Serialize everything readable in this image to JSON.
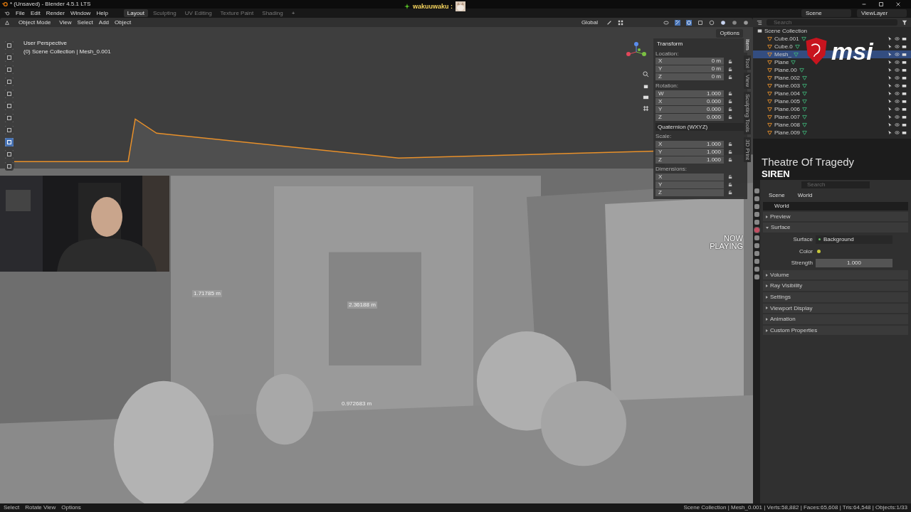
{
  "title_bar": {
    "title": "* (Unsaved) - Blender 4.5.1 LTS"
  },
  "menu": [
    "File",
    "Edit",
    "Render",
    "Window",
    "Help"
  ],
  "workspaces": [
    {
      "label": "Layout",
      "selected": true
    },
    {
      "label": "Sculpting",
      "selected": false
    },
    {
      "label": "UV Editing",
      "selected": false
    },
    {
      "label": "Texture Paint",
      "selected": false
    },
    {
      "label": "Shading",
      "selected": false
    }
  ],
  "add_workspace": "+",
  "scene_selector": {
    "scene": "Scene",
    "view_layer": "ViewLayer"
  },
  "chat": {
    "user": "wakuuwaku :"
  },
  "viewport_header": {
    "mode": "Object Mode",
    "menu": [
      "View",
      "Select",
      "Add",
      "Object"
    ],
    "orientation": "Global",
    "options": "Options"
  },
  "toolbar": [
    {
      "selected": false
    },
    {
      "selected": false
    },
    {
      "selected": false
    },
    {
      "selected": false
    },
    {
      "selected": false
    },
    {
      "selected": false
    },
    {
      "selected": false
    },
    {
      "selected": false
    },
    {
      "selected": true
    },
    {
      "selected": false
    },
    {
      "selected": false
    }
  ],
  "viewport": {
    "view_name": "User Perspective",
    "collection": "(0) Scene Collection | Mesh_0.001",
    "measurements": [
      {
        "text": "1.71785 m",
        "kind": "left"
      },
      {
        "text": "2.36188 m",
        "kind": "middle"
      },
      {
        "text": "0.972683 m",
        "kind": "bottom"
      }
    ]
  },
  "n_panel": {
    "title": "Transform",
    "tabs": [
      {
        "label": "Item",
        "selected": true
      },
      {
        "label": "Tool",
        "selected": false
      },
      {
        "label": "View",
        "selected": false
      },
      {
        "label": "Sculpting Tools",
        "selected": false
      },
      {
        "label": "3D Print",
        "selected": false
      }
    ],
    "sections": [
      {
        "kind": "group",
        "label": "Location:",
        "fields": [
          {
            "axis": "X",
            "value": "0 m"
          },
          {
            "axis": "Y",
            "value": "0 m"
          },
          {
            "axis": "Z",
            "value": "0 m"
          }
        ]
      },
      {
        "kind": "group",
        "label": "Rotation:",
        "fields": [
          {
            "axis": "W",
            "value": "1.000"
          },
          {
            "axis": "X",
            "value": "0.000"
          },
          {
            "axis": "Y",
            "value": "0.000"
          },
          {
            "axis": "Z",
            "value": "0.000"
          }
        ]
      },
      {
        "kind": "dropdown",
        "label": "Quaternion (WXYZ)"
      },
      {
        "kind": "group",
        "label": "Scale:",
        "fields": [
          {
            "axis": "X",
            "value": "1.000"
          },
          {
            "axis": "Y",
            "value": "1.000"
          },
          {
            "axis": "Z",
            "value": "1.000"
          }
        ]
      },
      {
        "kind": "group",
        "label": "Dimensions:",
        "fields": [
          {
            "axis": "X"
          },
          {
            "axis": "Y"
          },
          {
            "axis": "Z"
          }
        ]
      }
    ]
  },
  "now_playing": {
    "label": "NOW PLAYING",
    "title": "Theatre Of Tragedy",
    "artist": "SIREN"
  },
  "outliner": {
    "search": {
      "placeholder": "Search"
    },
    "root": "Scene Collection",
    "items": [
      {
        "name": "Cube.001",
        "selected": false
      },
      {
        "name": "Cube.0",
        "selected": false
      },
      {
        "name": "Mesh_",
        "selected": true
      },
      {
        "name": "Plane",
        "selected": false
      },
      {
        "name": "Plane.00",
        "selected": false
      },
      {
        "name": "Plane.002",
        "selected": false
      },
      {
        "name": "Plane.003",
        "selected": false
      },
      {
        "name": "Plane.004",
        "selected": false
      },
      {
        "name": "Plane.005",
        "selected": false
      },
      {
        "name": "Plane.006",
        "selected": false
      },
      {
        "name": "Plane.007",
        "selected": false
      },
      {
        "name": "Plane.008",
        "selected": false
      },
      {
        "name": "Plane.009",
        "selected": false
      }
    ]
  },
  "sponsor_logo": {
    "text": "msi"
  },
  "properties": {
    "search": {
      "placeholder": "Search"
    },
    "breadcrumb": [
      "Scene",
      "World"
    ],
    "world": "World",
    "tabs": [
      {
        "selected": false
      },
      {
        "selected": false
      },
      {
        "selected": false
      },
      {
        "selected": false
      },
      {
        "selected": false
      },
      {
        "selected": true
      },
      {
        "selected": false
      },
      {
        "selected": false
      },
      {
        "selected": false
      },
      {
        "selected": false
      },
      {
        "selected": false
      },
      {
        "selected": false
      }
    ],
    "panels": [
      {
        "title": "Preview",
        "expanded": false
      },
      {
        "title": "Surface",
        "expanded": true,
        "rows": [
          {
            "kind": "dropdown",
            "label": "Surface",
            "value": "Background"
          },
          {
            "kind": "color",
            "label": "Color"
          },
          {
            "kind": "number",
            "label": "Strength",
            "value": "1.000"
          }
        ]
      },
      {
        "title": "Volume",
        "expanded": false
      },
      {
        "title": "Ray Visibility",
        "expanded": false
      },
      {
        "title": "Settings",
        "expanded": false
      },
      {
        "title": "Viewport Display",
        "expanded": false
      },
      {
        "title": "Animation",
        "expanded": false
      },
      {
        "title": "Custom Properties",
        "expanded": false
      }
    ]
  },
  "status_bar": {
    "hints": [
      "Select",
      "Rotate View",
      "Options"
    ],
    "stats": "Scene Collection | Mesh_0.001 | Verts:58,882 | Faces:65,608 | Tris:64,548 | Objects:1/33"
  }
}
